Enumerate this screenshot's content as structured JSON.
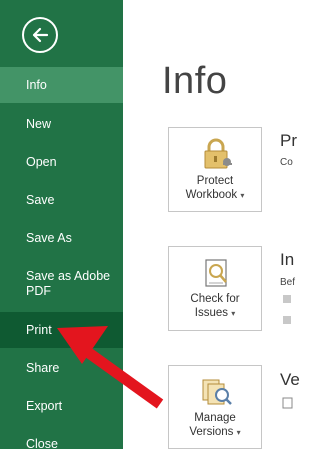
{
  "sidebar": {
    "items": [
      {
        "label": "Info"
      },
      {
        "label": "New"
      },
      {
        "label": "Open"
      },
      {
        "label": "Save"
      },
      {
        "label": "Save As"
      },
      {
        "label": "Save as Adobe\nPDF"
      },
      {
        "label": "Print"
      },
      {
        "label": "Share"
      },
      {
        "label": "Export"
      },
      {
        "label": "Close"
      }
    ],
    "selected": "Info",
    "hovered": "Print"
  },
  "main": {
    "title": "Info",
    "sections": [
      {
        "tile_line1": "Protect",
        "tile_line2": "Workbook",
        "heading": "Pr",
        "sub": "Co"
      },
      {
        "tile_line1": "Check for",
        "tile_line2": "Issues",
        "heading": "In",
        "sub": "Bef"
      },
      {
        "tile_line1": "Manage",
        "tile_line2": "Versions",
        "heading": "Ve",
        "sub": ""
      }
    ]
  },
  "icons": {
    "back": "back-arrow-icon",
    "protect": "lock-icon",
    "check": "inspect-document-icon",
    "versions": "manage-versions-icon",
    "annotation": "red-arrow-icon"
  },
  "colors": {
    "sidebar": "#217346",
    "selected": "#439467",
    "hovered": "#0f5a32",
    "arrow": "#e3151e"
  }
}
